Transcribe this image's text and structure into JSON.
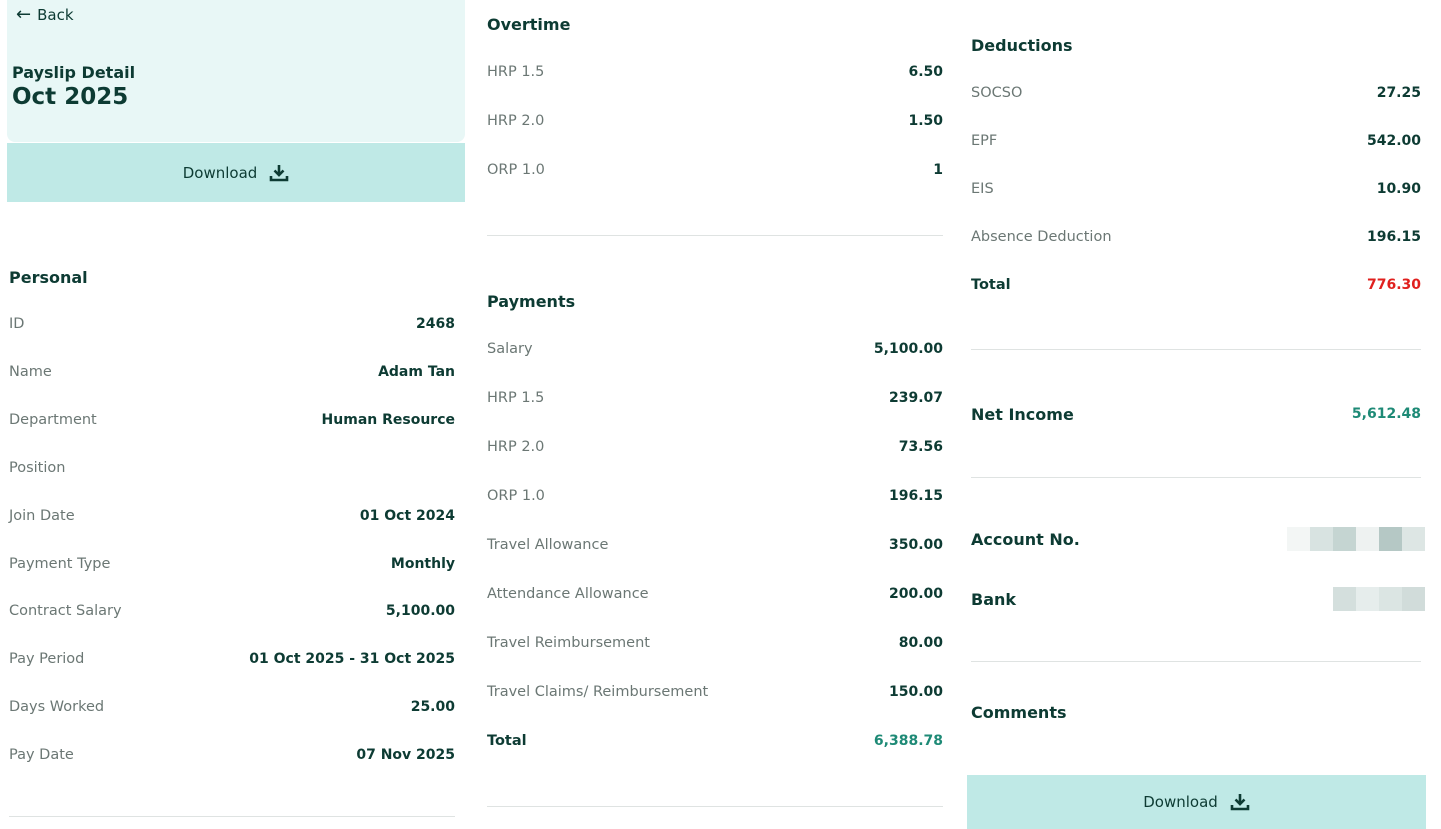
{
  "header": {
    "back_label": "Back",
    "title": "Payslip Detail",
    "period": "Oct 2025",
    "download_label": "Download"
  },
  "personal": {
    "title": "Personal",
    "rows": [
      {
        "label": "ID",
        "value": "2468"
      },
      {
        "label": "Name",
        "value": "Adam Tan"
      },
      {
        "label": "Department",
        "value": "Human Resource"
      },
      {
        "label": "Position",
        "value": ""
      },
      {
        "label": "Join Date",
        "value": "01 Oct 2024"
      },
      {
        "label": "Payment Type",
        "value": "Monthly"
      },
      {
        "label": "Contract Salary",
        "value": "5,100.00"
      },
      {
        "label": "Pay Period",
        "value": "01 Oct 2025 - 31 Oct 2025"
      },
      {
        "label": "Days Worked",
        "value": "25.00"
      },
      {
        "label": "Pay Date",
        "value": "07 Nov 2025"
      }
    ]
  },
  "overtime": {
    "title": "Overtime",
    "rows": [
      {
        "label": "HRP 1.5",
        "value": "6.50"
      },
      {
        "label": "HRP 2.0",
        "value": "1.50"
      },
      {
        "label": "ORP 1.0",
        "value": "1"
      }
    ]
  },
  "payments": {
    "title": "Payments",
    "rows": [
      {
        "label": "Salary",
        "value": "5,100.00"
      },
      {
        "label": "HRP 1.5",
        "value": "239.07"
      },
      {
        "label": "HRP 2.0",
        "value": "73.56"
      },
      {
        "label": "ORP 1.0",
        "value": "196.15"
      },
      {
        "label": "Travel Allowance",
        "value": "350.00"
      },
      {
        "label": "Attendance Allowance",
        "value": "200.00"
      },
      {
        "label": "Travel Reimbursement",
        "value": "80.00"
      },
      {
        "label": "Travel Claims/ Reimbursement",
        "value": "150.00"
      }
    ],
    "total_label": "Total",
    "total_value": "6,388.78"
  },
  "deductions": {
    "title": "Deductions",
    "rows": [
      {
        "label": "SOCSO",
        "value": "27.25"
      },
      {
        "label": "EPF",
        "value": "542.00"
      },
      {
        "label": "EIS",
        "value": "10.90"
      },
      {
        "label": "Absence Deduction",
        "value": "196.15"
      }
    ],
    "total_label": "Total",
    "total_value": "776.30"
  },
  "net_income": {
    "label": "Net Income",
    "value": "5,612.48"
  },
  "account": {
    "label": "Account No."
  },
  "bank": {
    "label": "Bank"
  },
  "comments": {
    "label": "Comments"
  },
  "footer": {
    "download_label": "Download"
  },
  "colors": {
    "accent_bg": "#bfe9e6",
    "header_bg": "#e8f7f6",
    "text_dark": "#0d3b33",
    "positive_green": "#1e8a76",
    "deduction_red": "#e0201e"
  },
  "icons": {
    "back": "arrow-left-icon",
    "download": "download-icon"
  }
}
